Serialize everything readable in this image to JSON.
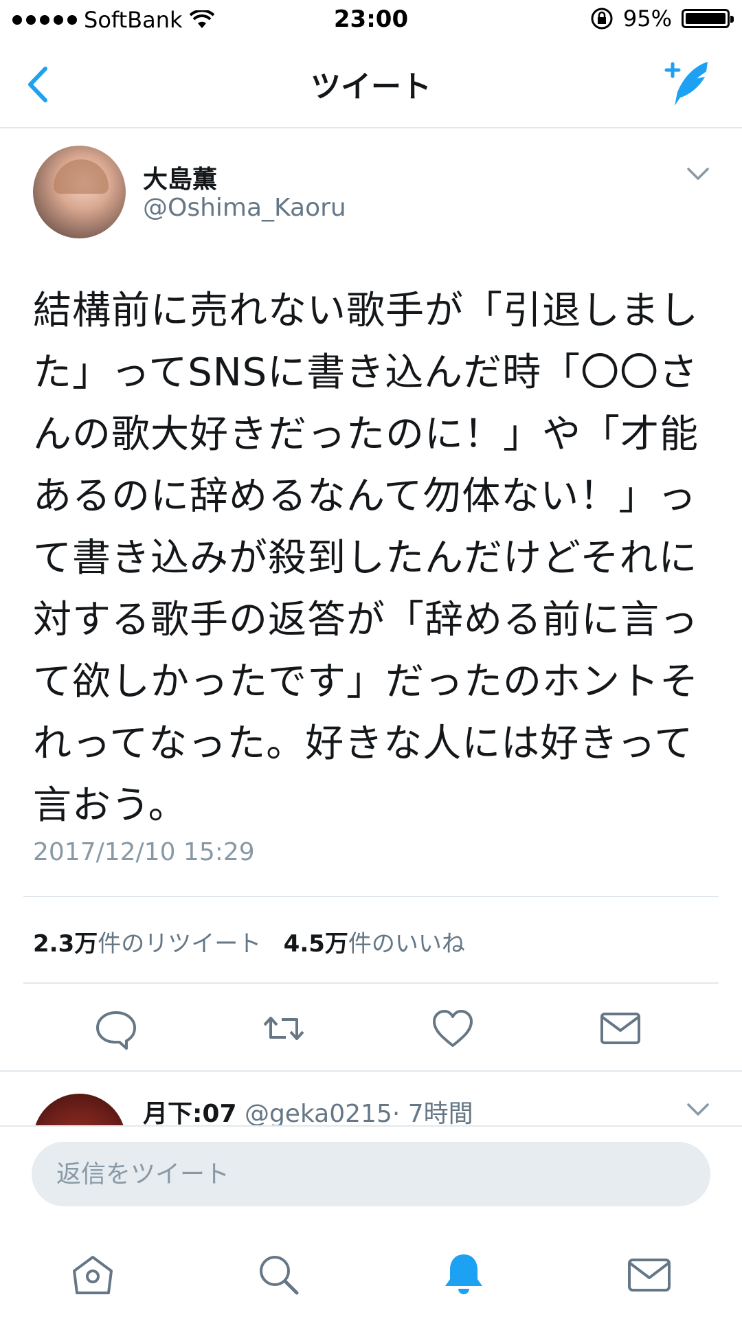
{
  "status_bar": {
    "carrier": "SoftBank",
    "time": "23:00",
    "battery": "95%"
  },
  "nav": {
    "title": "ツイート"
  },
  "tweet": {
    "author_name": "大島薫",
    "author_handle": "@Oshima_Kaoru",
    "text": "結構前に売れない歌手が「引退しました」ってSNSに書き込んだ時「〇〇さんの歌大好きだったのに！」や「才能あるのに辞めるなんて勿体ない！」って書き込みが殺到したんだけどそれに対する歌手の返答が「辞める前に言って欲しかったです」だったのホントそれってなった。好きな人には好きって言おう。",
    "timestamp": "2017/12/10 15:29",
    "retweet_count": "2.3万",
    "retweet_label": "件のリツイート",
    "like_count": "4.5万",
    "like_label": "件のいいね"
  },
  "reply_preview": {
    "name": "月下:07",
    "handle": "@geka0215",
    "time": "· 7時間"
  },
  "reply_box": {
    "placeholder": "返信をツイート"
  },
  "colors": {
    "accent": "#1da1f2",
    "icon_gray": "#657786"
  }
}
